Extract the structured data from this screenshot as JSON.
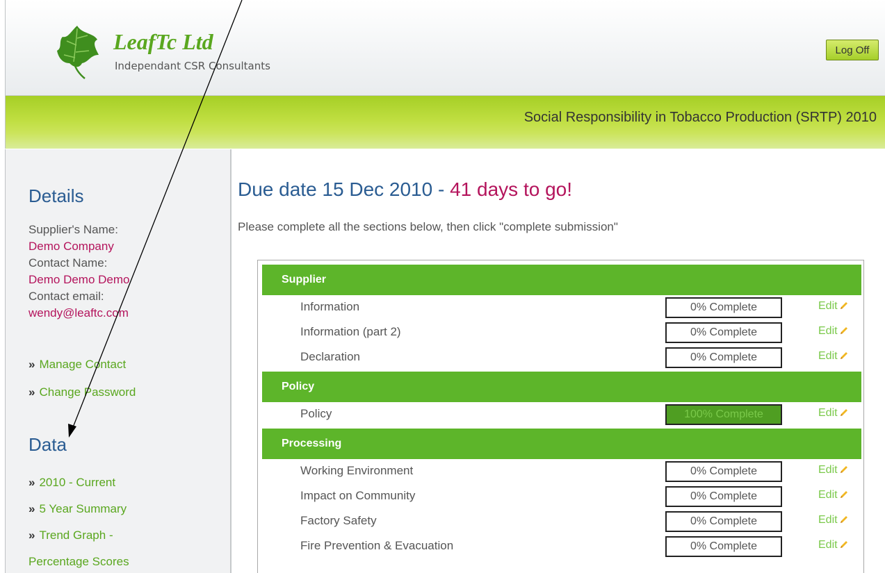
{
  "header": {
    "brand": "LeafTc Ltd",
    "tagline": "Independant CSR Consultants",
    "logoff_label": "Log Off"
  },
  "banner": {
    "title": "Social Responsibility in Tobacco Production (SRTP) 2010"
  },
  "sidebar": {
    "details_heading": "Details",
    "supplier_label": "Supplier's Name:",
    "supplier_value": "Demo Company",
    "contact_label": "Contact Name:",
    "contact_value": "Demo Demo Demo",
    "email_label": "Contact email:",
    "email_value": "wendy@leaftc.com",
    "links1": [
      "Manage Contact",
      "Change Password"
    ],
    "data_heading": "Data",
    "links2": [
      "2010 - Current",
      "5 Year Summary",
      "Trend Graph -"
    ],
    "links2_continuation": "Percentage Scores",
    "bullet": "»"
  },
  "main": {
    "due_prefix": "Due date 15 Dec 2010 - ",
    "due_days": "41 days to go!",
    "instructions": "Please complete all the sections below, then click \"complete submission\"",
    "edit_label": "Edit",
    "sections": [
      {
        "title": "Supplier",
        "items": [
          {
            "name": "Information",
            "status": "0% Complete",
            "progress": 0
          },
          {
            "name": "Information (part 2)",
            "status": "0% Complete",
            "progress": 0
          },
          {
            "name": "Declaration",
            "status": "0% Complete",
            "progress": 0
          }
        ]
      },
      {
        "title": "Policy",
        "items": [
          {
            "name": "Policy",
            "status": "100% Complete",
            "progress": 100
          }
        ]
      },
      {
        "title": "Processing",
        "items": [
          {
            "name": "Working Environment",
            "status": "0% Complete",
            "progress": 0
          },
          {
            "name": "Impact on Community",
            "status": "0% Complete",
            "progress": 0
          },
          {
            "name": "Factory Safety",
            "status": "0% Complete",
            "progress": 0
          },
          {
            "name": "Fire Prevention & Evacuation",
            "status": "0% Complete",
            "progress": 0
          }
        ]
      }
    ]
  },
  "colors": {
    "accent_green": "#5db52a",
    "heading_blue": "#2a5c92",
    "value_magenta": "#b4145c",
    "link_green": "#5aa71f"
  },
  "icons": [
    "leaf-logo",
    "pencil-icon",
    "annotation-arrow"
  ]
}
